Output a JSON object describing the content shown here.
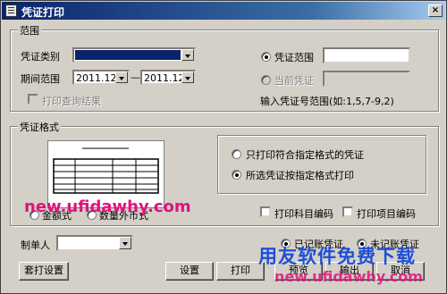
{
  "window": {
    "title": "凭证打印",
    "close_label": "×"
  },
  "range": {
    "legend": "范围",
    "voucher_type_label": "凭证类别",
    "period_label": "期间范围",
    "period_from": "2011.12",
    "period_sep": "—",
    "period_to": "2011.12",
    "print_query_label": "打印查询结果",
    "voucher_range_label": "凭证范围",
    "current_voucher_label": "当前凭证",
    "hint": "输入凭证号范围(如:1,5,7-9,2)"
  },
  "format": {
    "legend": "凭证格式",
    "option1": "只打印符合指定格式的凭证",
    "option2": "所选凭证按指定格式打印",
    "left_cap_1": "金额式",
    "left_cap_2": "数量外币式",
    "print_subject_code": "打印科目编码",
    "print_item_code": "打印项目编码"
  },
  "bottom": {
    "maker_label": "制单人",
    "posted_label": "已记账凭证",
    "unposted_label": "未记账凭证",
    "btn_template": "套打设置",
    "btn_settings": "设置",
    "btn_print": "打印",
    "btn_preview": "预览",
    "btn_output": "输出",
    "btn_cancel": "取消"
  },
  "watermark": {
    "text_left": "new.ufidawhy.com",
    "text_right_top": "用友软件免费下载",
    "text_right_bottom": "new.ufidawhy.com"
  }
}
